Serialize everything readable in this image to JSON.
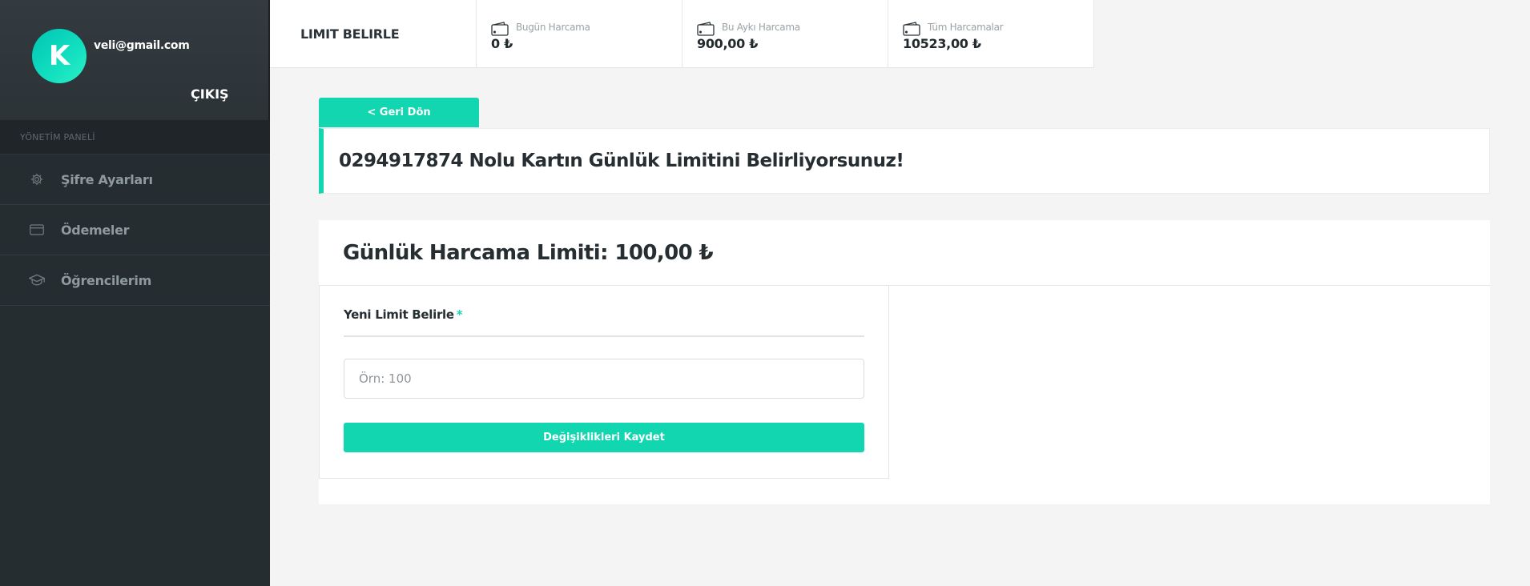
{
  "user": {
    "avatar_letter": "K",
    "email": "veli@gmail.com",
    "logout_label": "ÇIKIŞ"
  },
  "sidebar": {
    "section_title": "YÖNETİM PANELİ",
    "items": [
      {
        "label": "Şifre Ayarları",
        "icon": "gear-icon"
      },
      {
        "label": "Ödemeler",
        "icon": "credit-card-icon"
      },
      {
        "label": "Öğrencilerim",
        "icon": "graduation-cap-icon"
      }
    ]
  },
  "topbar": {
    "title": "LIMIT BELIRLE",
    "stats": [
      {
        "label": "Bugün Harcama",
        "value": "0 ₺",
        "icon": "wallet-icon"
      },
      {
        "label": "Bu Aykı Harcama",
        "value": "900,00 ₺",
        "icon": "wallet-icon"
      },
      {
        "label": "Tüm Harcamalar",
        "value": "10523,00 ₺",
        "icon": "wallet-icon"
      }
    ]
  },
  "main": {
    "back_label": "< Geri Dön",
    "alert_text": "0294917874 Nolu Kartın Günlük Limitini Belirliyorsunuz!",
    "card_title": "Günlük Harcama Limiti: 100,00 ₺",
    "form": {
      "label": "Yeni Limit Belirle",
      "required_mark": "*",
      "input_value": "",
      "input_placeholder": "Örn: 100",
      "submit_label": "Değişiklikleri Kaydet"
    }
  },
  "colors": {
    "accent": "#12d6b0",
    "sidebar_bg": "#262d31",
    "page_bg": "#f4f4f4"
  }
}
